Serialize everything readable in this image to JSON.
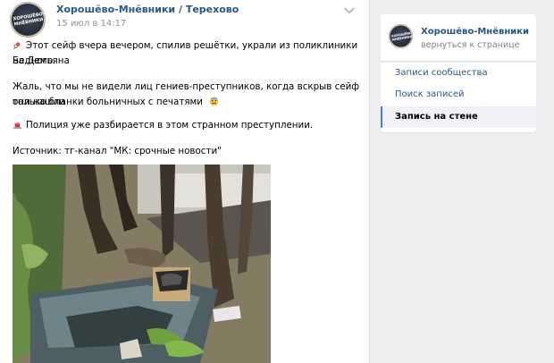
{
  "post": {
    "author": "Хорошёво-Мнёвники / Терехово",
    "date": "15 июл в 14:17",
    "avatar_text": "ХОРОШЁВО-МНЁВНИКИ",
    "paragraph1_line1": "Этот сейф вчера вечером, спилив решётки, украли из поликлиники на Демьяна",
    "paragraph1_line2": "Бедного.",
    "paragraph2_line1": "Жаль, что мы не видели лиц гениев-преступников, когда вскрыв сейф они нашли",
    "paragraph2_line2": "только бланки больничных с печатями",
    "paragraph3": "Полиция уже разбирается в этом странном преступлении.",
    "source": "Источник: тг-канал \"МК: срочные новости\"",
    "icons": {
      "p1": "syringe-emoji-icon",
      "p2": "worried-face-emoji-icon",
      "p3": "police-light-emoji-icon",
      "menu": "chevron-down-icon"
    }
  },
  "sidebar": {
    "title": "Хорошёво-Мнёвники / Т...",
    "back_link": "вернуться к странице",
    "avatar_text": "ХОРОШЁВО-МНЁВНИКИ",
    "menu": [
      {
        "label": "Записи сообщества",
        "active": false
      },
      {
        "label": "Поиск записей",
        "active": false
      },
      {
        "label": "Запись на стене",
        "active": true
      }
    ]
  },
  "colors": {
    "link": "#2a5885",
    "page_bg": "#edeef0",
    "accent": "#5181b8"
  }
}
